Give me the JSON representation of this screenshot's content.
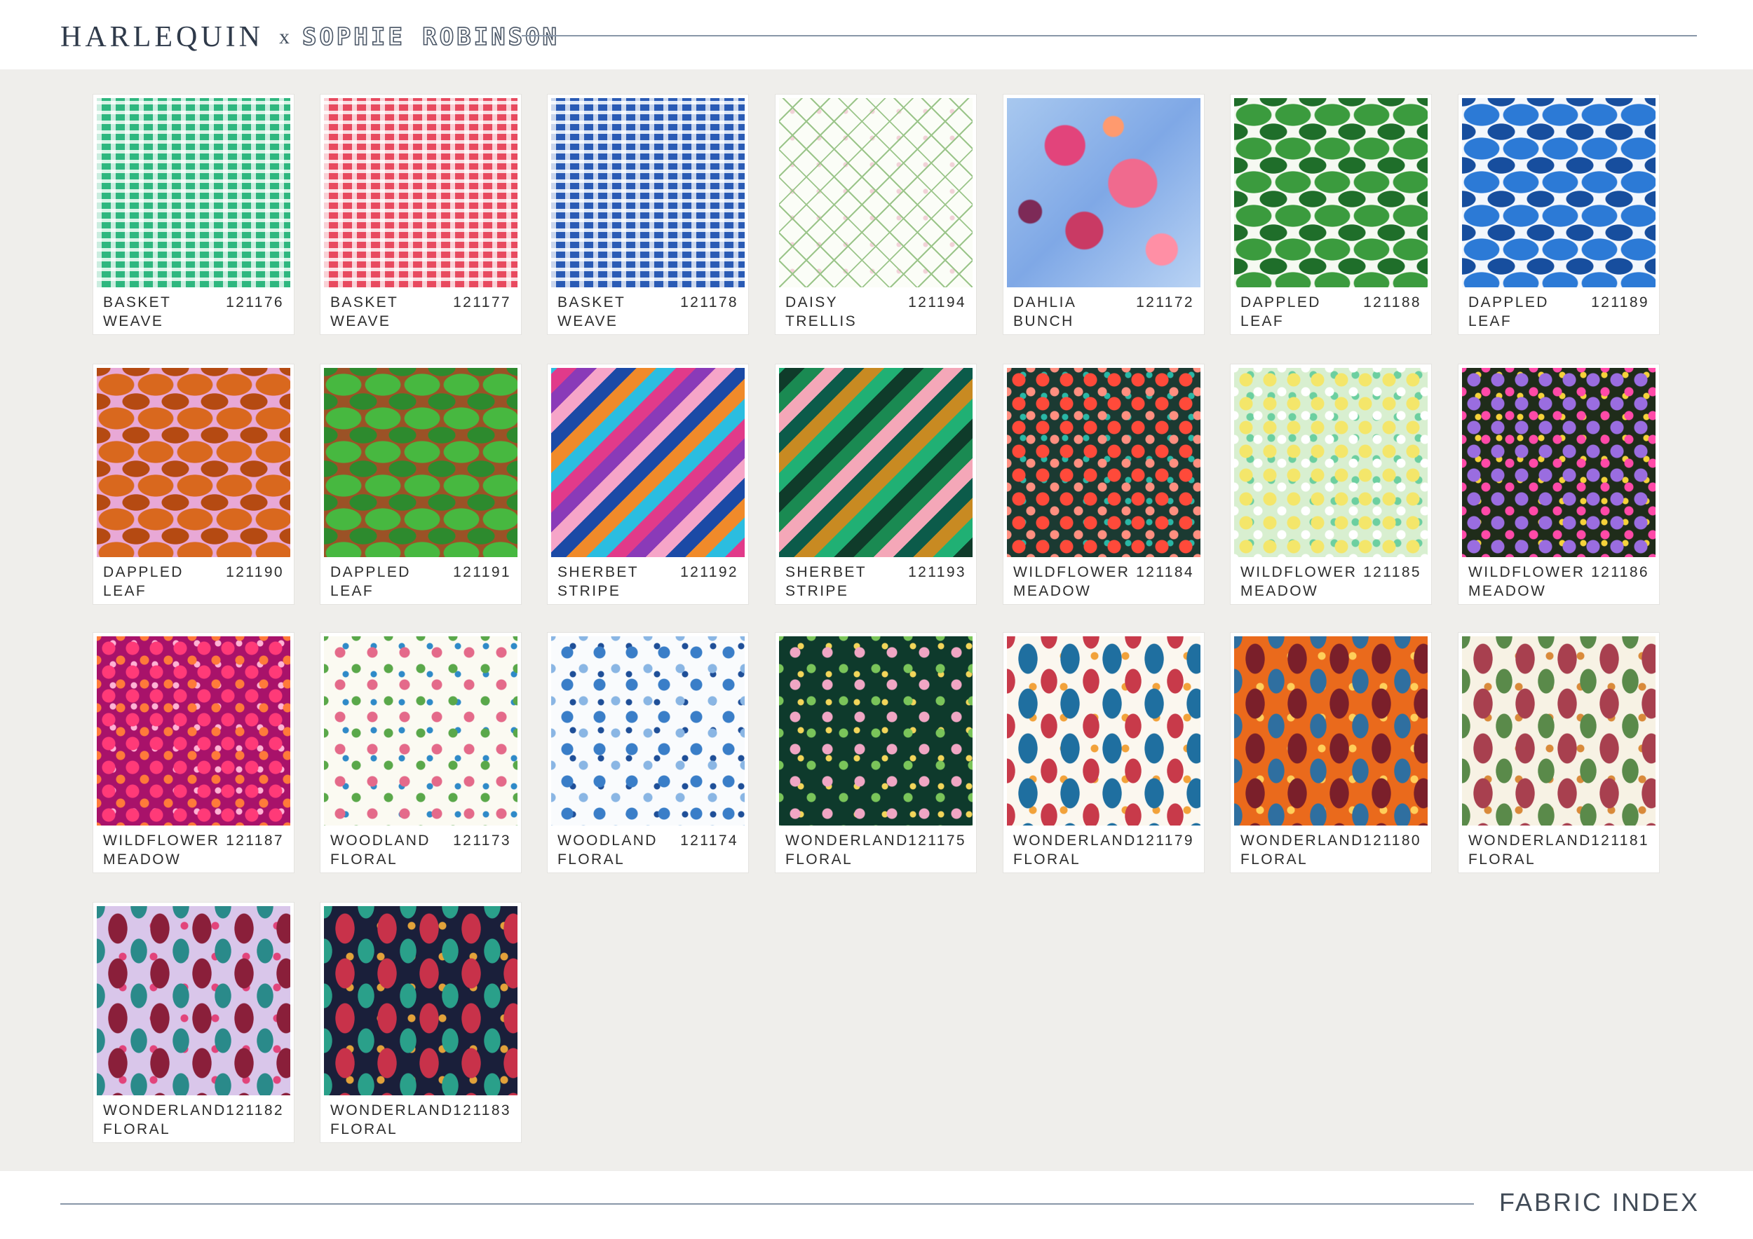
{
  "header": {
    "brand": "HARLEQUIN",
    "separator": "x",
    "collaborator": "SOPHIE ROBINSON"
  },
  "footer": {
    "title": "FABRIC INDEX"
  },
  "fabrics": [
    {
      "name": "BASKET\nWEAVE",
      "code": "121176"
    },
    {
      "name": "BASKET\nWEAVE",
      "code": "121177"
    },
    {
      "name": "BASKET\nWEAVE",
      "code": "121178"
    },
    {
      "name": "DAISY\nTRELLIS",
      "code": "121194"
    },
    {
      "name": "DAHLIA\nBUNCH",
      "code": "121172"
    },
    {
      "name": "DAPPLED\nLEAF",
      "code": "121188"
    },
    {
      "name": "DAPPLED\nLEAF",
      "code": "121189"
    },
    {
      "name": "DAPPLED\nLEAF",
      "code": "121190"
    },
    {
      "name": "DAPPLED\nLEAF",
      "code": "121191"
    },
    {
      "name": "SHERBET\nSTRIPE",
      "code": "121192"
    },
    {
      "name": "SHERBET\nSTRIPE",
      "code": "121193"
    },
    {
      "name": "WILDFLOWER\nMEADOW",
      "code": "121184"
    },
    {
      "name": "WILDFLOWER\nMEADOW",
      "code": "121185"
    },
    {
      "name": "WILDFLOWER\nMEADOW",
      "code": "121186"
    },
    {
      "name": "WILDFLOWER\nMEADOW",
      "code": "121187"
    },
    {
      "name": "WOODLAND\nFLORAL",
      "code": "121173"
    },
    {
      "name": "WOODLAND\nFLORAL",
      "code": "121174"
    },
    {
      "name": "WONDERLAND\nFLORAL",
      "code": "121175"
    },
    {
      "name": "WONDERLAND\nFLORAL",
      "code": "121179"
    },
    {
      "name": "WONDERLAND\nFLORAL",
      "code": "121180"
    },
    {
      "name": "WONDERLAND\nFLORAL",
      "code": "121181"
    },
    {
      "name": "WONDERLAND\nFLORAL",
      "code": "121182"
    },
    {
      "name": "WONDERLAND\nFLORAL",
      "code": "121183"
    }
  ]
}
